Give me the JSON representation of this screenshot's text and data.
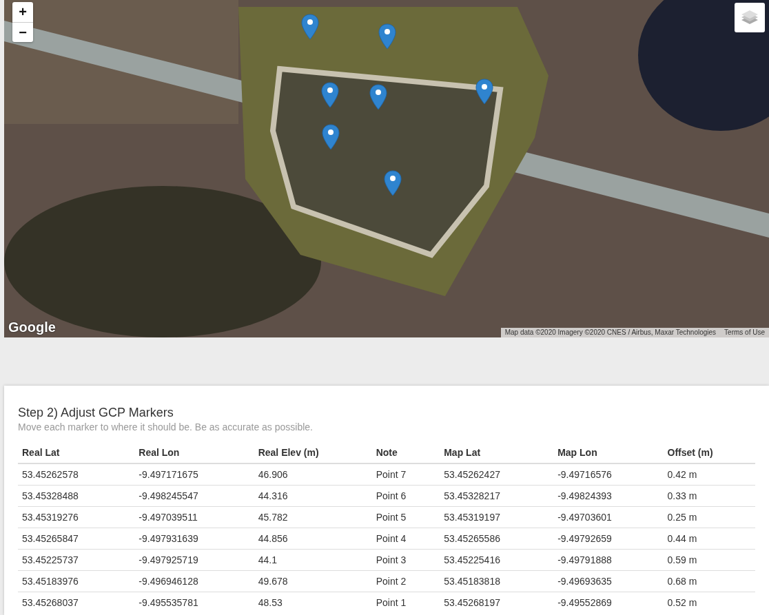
{
  "map": {
    "zoom_in": "+",
    "zoom_out": "−",
    "logo": "Google",
    "attribution": "Map data ©2020 Imagery ©2020 CNES / Airbus, Maxar Technologies",
    "terms": "Terms of Use"
  },
  "step": {
    "title": "Step 2) Adjust GCP Markers",
    "subtitle": "Move each marker to where it should be. Be as accurate as possible."
  },
  "table": {
    "columns": [
      "Real Lat",
      "Real Lon",
      "Real Elev (m)",
      "Note",
      "Map Lat",
      "Map Lon",
      "Offset (m)"
    ],
    "rows": [
      [
        "53.45262578",
        "-9.497171675",
        "46.906",
        "Point 7",
        "53.45262427",
        "-9.49716576",
        "0.42 m"
      ],
      [
        "53.45328488",
        "-9.498245547",
        "44.316",
        "Point 6",
        "53.45328217",
        "-9.49824393",
        "0.33 m"
      ],
      [
        "53.45319276",
        "-9.497039511",
        "45.782",
        "Point 5",
        "53.45319197",
        "-9.49703601",
        "0.25 m"
      ],
      [
        "53.45265847",
        "-9.497931639",
        "44.856",
        "Point 4",
        "53.45265586",
        "-9.49792659",
        "0.44 m"
      ],
      [
        "53.45225737",
        "-9.497925719",
        "44.1",
        "Point 3",
        "53.45225416",
        "-9.49791888",
        "0.59 m"
      ],
      [
        "53.45183976",
        "-9.496946128",
        "49.678",
        "Point 2",
        "53.45183818",
        "-9.49693635",
        "0.68 m"
      ],
      [
        "53.45268037",
        "-9.495535781",
        "48.53",
        "Point 1",
        "53.45268197",
        "-9.49552869",
        "0.52 m"
      ]
    ]
  }
}
